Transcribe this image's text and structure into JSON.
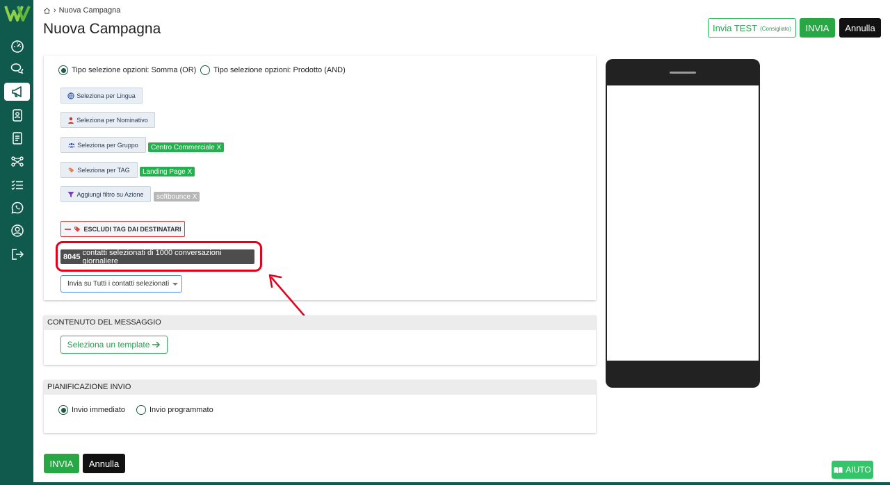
{
  "header": {
    "breadcrumb_current": "Nuova Campagna",
    "page_title": "Nuova Campagna",
    "test_button_label": "Invia TEST",
    "test_button_note": "(Consigliato)",
    "send_label": "INVIA",
    "cancel_label": "Annulla"
  },
  "sidebar": {
    "items": [
      {
        "icon": "dashboard-icon",
        "active": false
      },
      {
        "icon": "chat-icon",
        "active": false
      },
      {
        "icon": "megaphone-icon",
        "active": true
      },
      {
        "icon": "contacts-icon",
        "active": false
      },
      {
        "icon": "document-icon",
        "active": false
      },
      {
        "icon": "flow-icon",
        "active": false
      },
      {
        "icon": "checklist-icon",
        "active": false
      },
      {
        "icon": "whatsapp-icon",
        "active": false
      },
      {
        "icon": "user-circle-icon",
        "active": false
      },
      {
        "icon": "logout-icon",
        "active": false
      }
    ]
  },
  "recipients": {
    "option_or": "Tipo selezione opzioni: Somma (OR)",
    "option_and": "Tipo selezione opzioni: Prodotto (AND)",
    "selected_option": "or",
    "filters": {
      "language": "Seleziona per Lingua",
      "name": "Seleziona per Nominativo",
      "group": "Seleziona per Gruppo",
      "tag": "Seleziona per TAG",
      "action": "Aggiungi filtro su Azione"
    },
    "tags": {
      "group": "Centro Commerciale X",
      "tag": "Landing Page  X",
      "action": "softbounce X"
    },
    "exclude_label": "ESCLUDI TAG DAI DESTINATARI",
    "count_number": "8045",
    "count_text": "contatti selezionati di 1000 conversazioni giornaliere",
    "send_option": "Invia su Tutti i contatti selezionati"
  },
  "content": {
    "section_title": "CONTENUTO DEL MESSAGGIO",
    "template_button": "Seleziona un template"
  },
  "schedule": {
    "section_title": "PIANIFICAZIONE INVIO",
    "option_immediate": "Invio immediato",
    "option_scheduled": "Invio programmato",
    "selected": "immediate"
  },
  "footer": {
    "send_label": "INVIA",
    "cancel_label": "Annulla",
    "help_label": "AIUTO"
  },
  "colors": {
    "sidebar": "#0f5a4c",
    "primary_green": "#28a745",
    "highlight_red": "#e3001b"
  }
}
